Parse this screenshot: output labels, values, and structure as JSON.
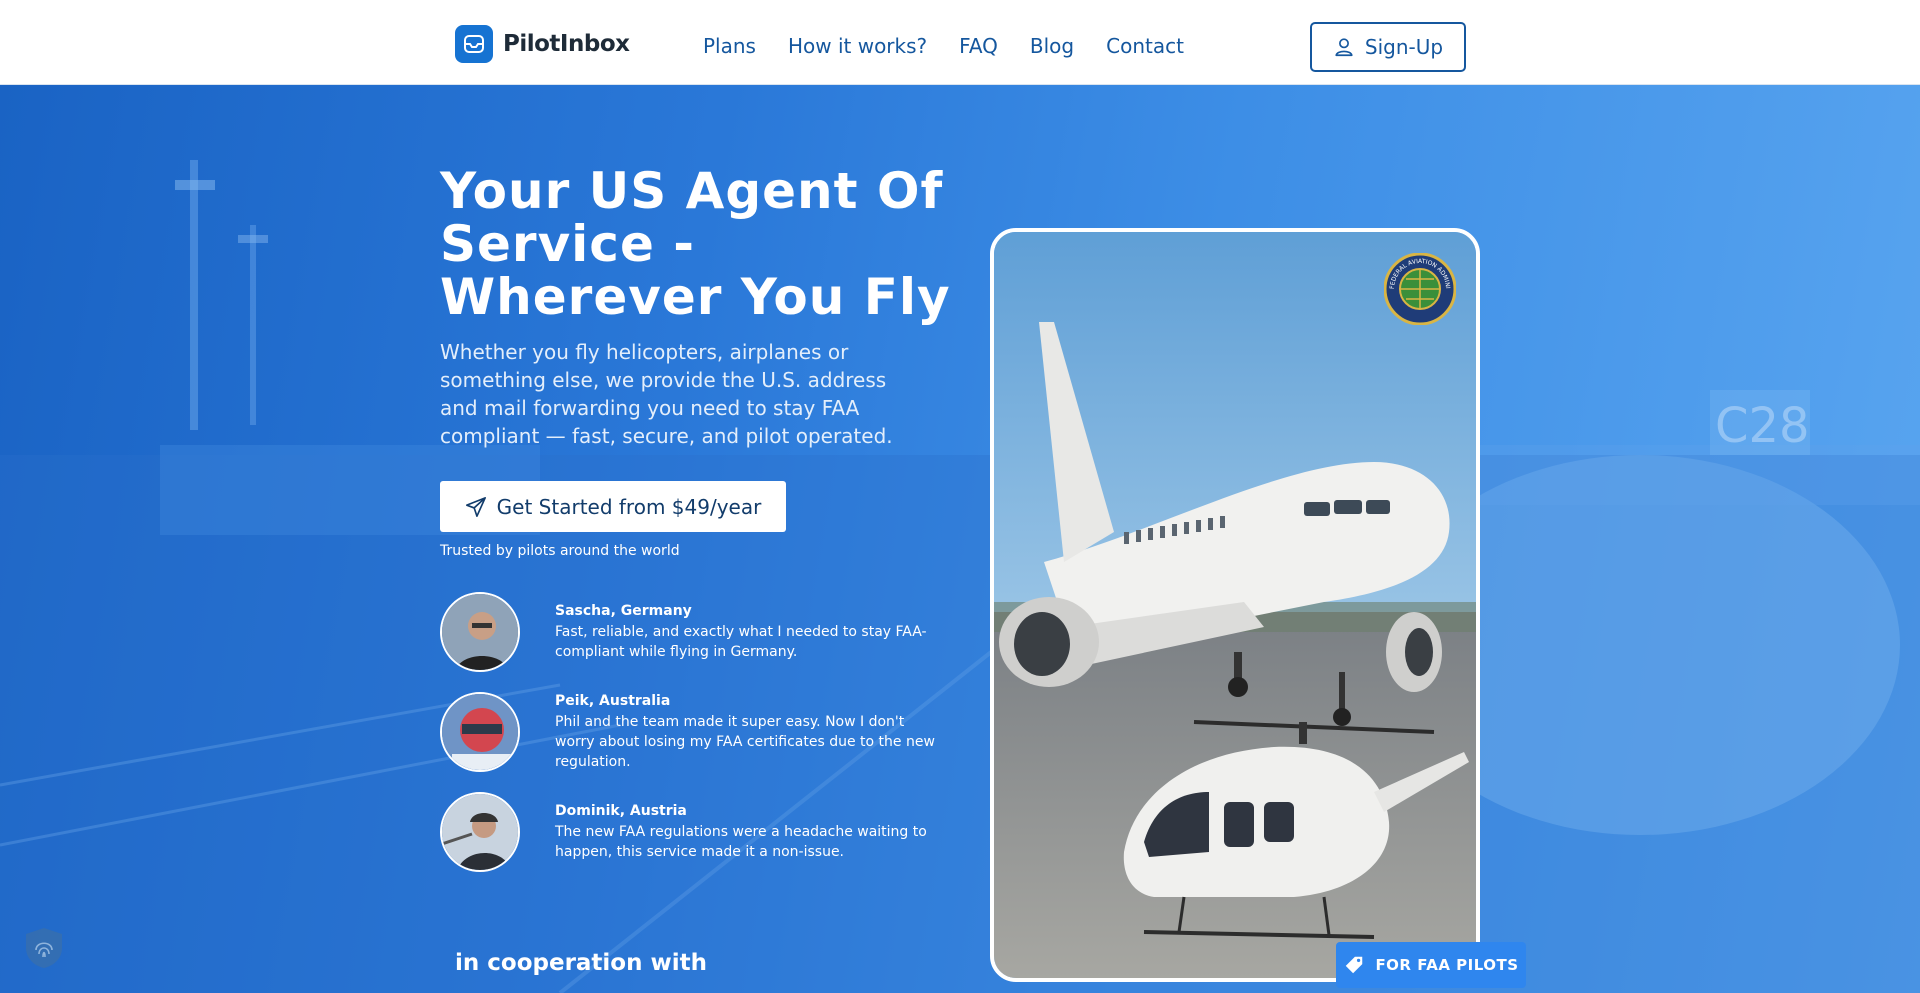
{
  "header": {
    "brand": "PilotInbox",
    "nav": [
      "Plans",
      "How it works?",
      "FAQ",
      "Blog",
      "Contact"
    ],
    "signup_label": "Sign-Up"
  },
  "hero": {
    "headline": "Your US Agent Of Service - Wherever You Fly",
    "subtext": "Whether you fly helicopters, airplanes or something else, we provide the U.S. address and mail forwarding you need to stay FAA compliant — fast, secure, and pilot operated.",
    "cta_label": "Get Started from $49/year",
    "trusted_text": "Trusted by pilots around the world",
    "cooperation_heading": "in cooperation with",
    "badge_label": "FOR FAA PILOTS"
  },
  "testimonials": [
    {
      "name": "Sascha, Germany",
      "quote": "Fast, reliable, and exactly what I needed to stay FAA-compliant while flying in Germany."
    },
    {
      "name": "Peik, Australia",
      "quote": "Phil and the team made it super easy. Now I don't worry about losing my FAA certificates due to the new regulation."
    },
    {
      "name": "Dominik, Austria",
      "quote": "The new FAA regulations were a headache waiting to happen, this service made it a non-issue."
    }
  ],
  "background": {
    "gate_sign": "C28"
  },
  "seal": {
    "text": "FEDERAL AVIATION ADMINISTRATION"
  },
  "colors": {
    "brand": "#1673d2",
    "nav": "#15579e",
    "hero": "#2a78d8",
    "badge": "#2f86ee"
  },
  "icons": {
    "logo": "mail-icon",
    "signup": "user-icon",
    "cta": "paper-plane-icon",
    "badge": "tag-icon",
    "security": "fingerprint-shield-icon"
  }
}
